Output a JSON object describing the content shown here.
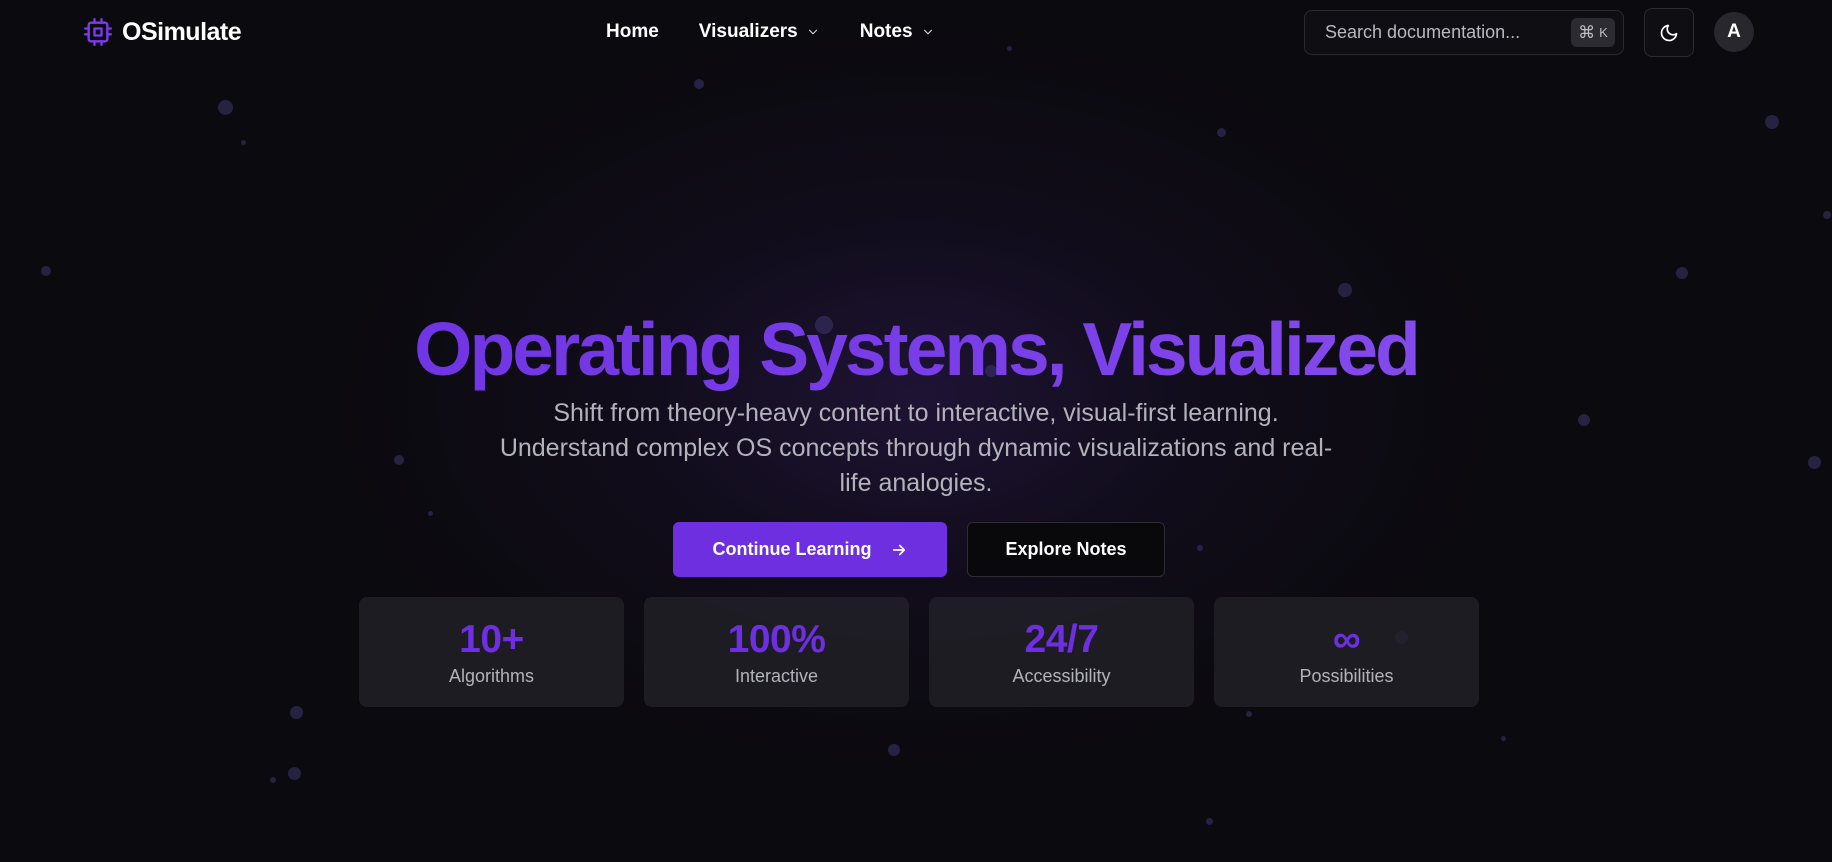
{
  "brand": {
    "name": "OSimulate",
    "icon": "cpu-chip-icon",
    "accent": "#6d2fe0"
  },
  "nav": {
    "home": "Home",
    "visualizers": "Visualizers",
    "notes": "Notes"
  },
  "search": {
    "placeholder": "Search documentation...",
    "shortcut_symbol": "⌘",
    "shortcut_key": "K"
  },
  "theme_toggle": {
    "icon": "moon-icon"
  },
  "user": {
    "avatar_initial": "A"
  },
  "hero": {
    "title": "Operating Systems, Visualized",
    "subtitle": "Shift from theory-heavy content to interactive, visual-first learning. Understand complex OS concepts through dynamic visualizations and real-life analogies.",
    "primary_cta": "Continue Learning",
    "secondary_cta": "Explore Notes"
  },
  "stats": [
    {
      "value": "10+",
      "label": "Algorithms"
    },
    {
      "value": "100%",
      "label": "Interactive"
    },
    {
      "value": "24/7",
      "label": "Accessibility"
    },
    {
      "value": "∞",
      "label": "Possibilities"
    }
  ]
}
